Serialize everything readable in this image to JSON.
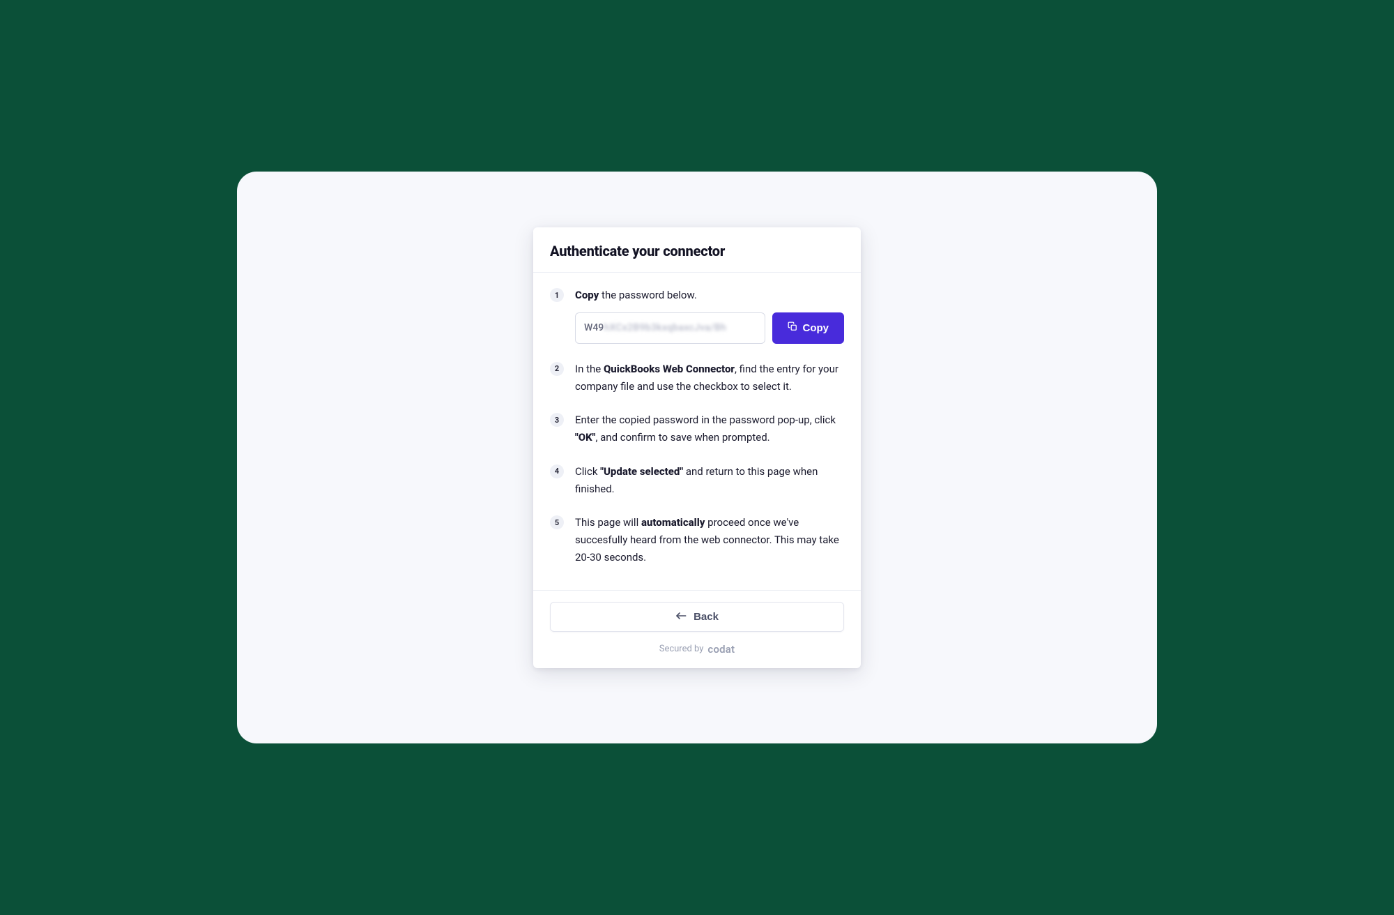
{
  "title": "Authenticate your connector",
  "steps": {
    "s1": {
      "num": "1",
      "bold": "Copy",
      "rest": " the password below.",
      "password_visible": "W49",
      "password_blur": "hXCx2B9b3kxqbaxcJva/Bh",
      "copy_label": "Copy"
    },
    "s2": {
      "num": "2",
      "pre": "In the ",
      "bold": "QuickBooks Web Connector",
      "post": ", find the entry for your company file and use the checkbox to select it."
    },
    "s3": {
      "num": "3",
      "pre": "Enter the copied password in the password pop-up, click ",
      "bold": "\"OK\"",
      "post": ", and confirm to save when prompted."
    },
    "s4": {
      "num": "4",
      "pre": "Click ",
      "bold": "\"Update selected\"",
      "post": " and return to this page when finished."
    },
    "s5": {
      "num": "5",
      "pre": "This page will ",
      "bold": "automatically",
      "post": " proceed once we've succesfully heard from the web connector. This may take 20-30 seconds."
    }
  },
  "footer": {
    "back_label": "Back",
    "secured_prefix": "Secured by",
    "secured_brand": "codat"
  }
}
